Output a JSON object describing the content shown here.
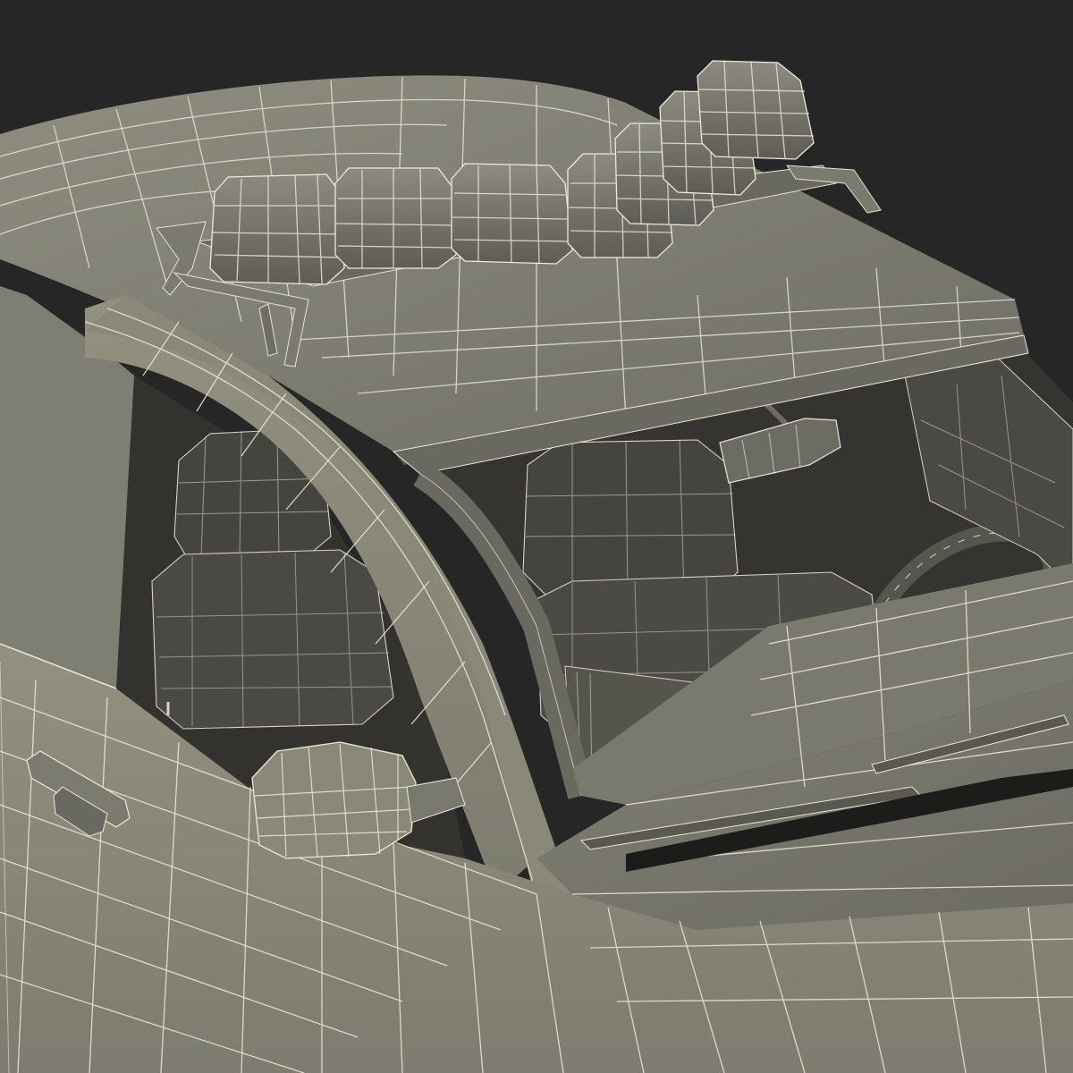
{
  "scene": {
    "colors": {
      "background": "#262626",
      "body_light": "#8f8e82",
      "body_mid": "#76756a",
      "body_dark": "#5c5b52",
      "interior": "#3f3e39",
      "interior_dark": "#2e2d29",
      "glass": "#1c1c1b",
      "wire": "#e8e6da"
    }
  }
}
